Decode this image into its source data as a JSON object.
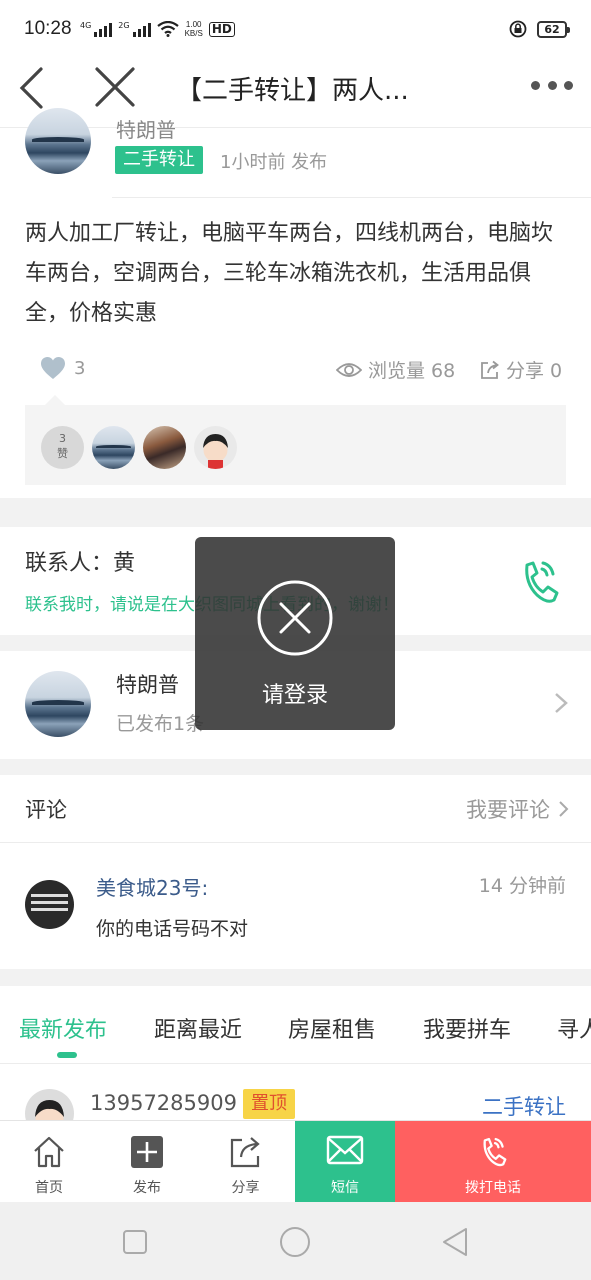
{
  "status_bar": {
    "time": "10:28",
    "net1": "4G",
    "net2": "2G",
    "speed_value": "1.00",
    "speed_unit": "KB/S",
    "hd": "HD",
    "battery": "62"
  },
  "header": {
    "title": "【二手转让】两人..."
  },
  "author": {
    "name_partial": "特朗普",
    "category": "二手转让",
    "post_time": "1小时前 发布"
  },
  "post": {
    "content": "两人加工厂转让，电脑平车两台，四线机两台，电脑坎车两台，空调两台，三轮车冰箱洗衣机，生活用品俱全，价格实惠"
  },
  "stats": {
    "likes": "3",
    "views_label": "浏览量 68",
    "share_label": "分享 0"
  },
  "likers": {
    "count": "3",
    "count_suffix": "赞"
  },
  "contact": {
    "name": "联系人：黄",
    "tip": "联系我时，请说是在大织图同城上看到的，谢谢！"
  },
  "publisher": {
    "name": "特朗普",
    "count": "已发布1条"
  },
  "comments": {
    "title": "评论",
    "write_label": "我要评论",
    "items": [
      {
        "user": "美食城23号:",
        "time": "14 分钟前",
        "text": "你的电话号码不对"
      }
    ]
  },
  "tabs": [
    "最新发布",
    "距离最近",
    "房屋租售",
    "我要拼车",
    "寻人"
  ],
  "list": {
    "phone": "13957285909",
    "top_badge": "置顶",
    "category": "二手转让"
  },
  "bottom_nav": {
    "home": "首页",
    "publish": "发布",
    "share": "分享",
    "sms": "短信",
    "call": "拨打电话"
  },
  "toast": {
    "text": "请登录"
  },
  "colors": {
    "accent": "#2dc18d",
    "call": "#ff6060",
    "link": "#3b72c4"
  }
}
